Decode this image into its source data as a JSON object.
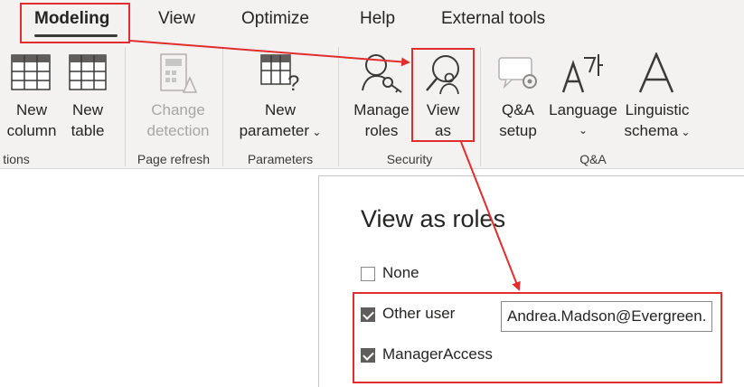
{
  "tabs": {
    "modeling": "Modeling",
    "view": "View",
    "optimize": "Optimize",
    "help": "Help",
    "external_tools": "External tools"
  },
  "ribbon": {
    "new_column": [
      "New",
      "column"
    ],
    "new_table": [
      "New",
      "table"
    ],
    "change_detection": [
      "Change",
      "detection"
    ],
    "new_parameter": [
      "New",
      "parameter"
    ],
    "manage_roles": [
      "Manage",
      "roles"
    ],
    "view_as": [
      "View",
      "as"
    ],
    "qa_setup": [
      "Q&A",
      "setup"
    ],
    "language": "Language",
    "linguistic_schema": [
      "Linguistic",
      "schema"
    ],
    "groups": {
      "calculations": "tions",
      "page_refresh": "Page refresh",
      "parameters": "Parameters",
      "security": "Security",
      "qa": "Q&A"
    }
  },
  "pane": {
    "title": "View as roles",
    "options": {
      "none": "None",
      "other_user": "Other user",
      "manager_access": "ManagerAccess"
    },
    "other_user_value": "Andrea.Madson@Evergreen.",
    "checked": {
      "none": false,
      "other_user": true,
      "manager_access": true
    }
  },
  "colors": {
    "highlight": "#e02d2d",
    "ribbon_bg": "#f3f2f1",
    "checkbox_checked": "#605e5c"
  },
  "icons": [
    "table-add-column-icon",
    "table-add-icon",
    "change-detection-icon",
    "parameter-icon",
    "manage-roles-icon",
    "view-as-icon",
    "qa-setup-icon",
    "language-icon",
    "linguistic-schema-icon",
    "chevron-down-icon",
    "checkmark-icon"
  ]
}
